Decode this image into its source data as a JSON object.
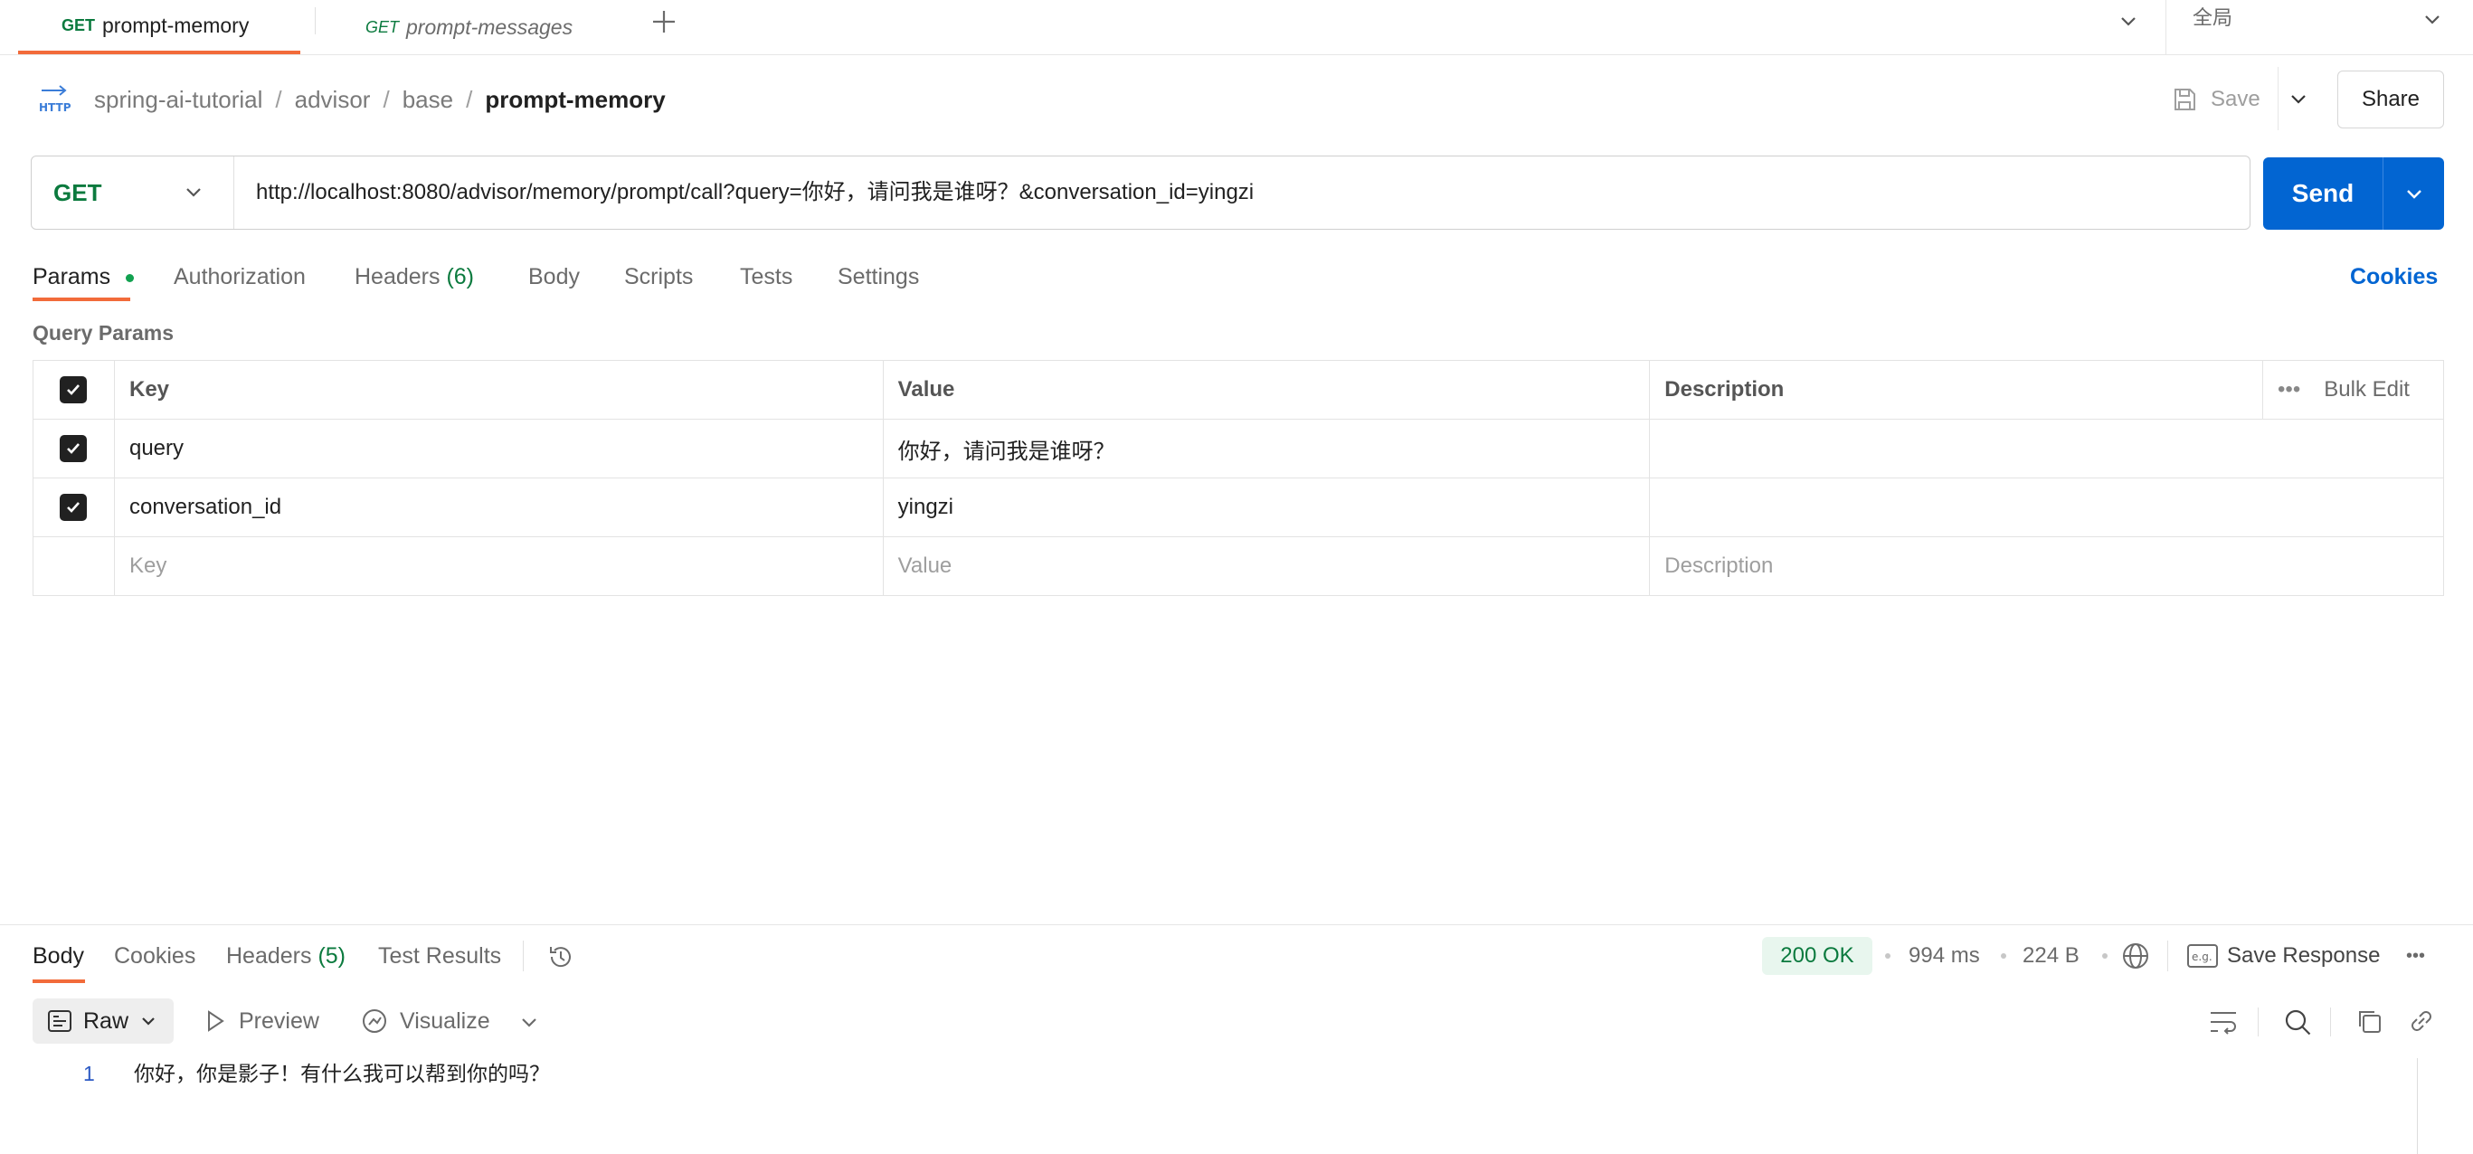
{
  "tabs": [
    {
      "method": "GET",
      "name": "prompt-memory"
    },
    {
      "method": "GET",
      "name": "prompt-messages"
    }
  ],
  "environment": {
    "selected": "全局"
  },
  "breadcrumb": [
    "spring-ai-tutorial",
    "advisor",
    "base",
    "prompt-memory"
  ],
  "header_actions": {
    "save_label": "Save",
    "share_label": "Share"
  },
  "request": {
    "method": "GET",
    "url": "http://localhost:8080/advisor/memory/prompt/call?query=你好，请问我是谁呀？&conversation_id=yingzi",
    "send_label": "Send"
  },
  "request_tabs": {
    "params": "Params",
    "authorization": "Authorization",
    "headers": "Headers",
    "headers_count": "(6)",
    "body": "Body",
    "scripts": "Scripts",
    "tests": "Tests",
    "settings": "Settings",
    "cookies": "Cookies"
  },
  "params": {
    "section_title": "Query Params",
    "columns": {
      "key": "Key",
      "value": "Value",
      "description": "Description",
      "bulk_edit": "Bulk Edit"
    },
    "rows": [
      {
        "key": "query",
        "value": "你好，请问我是谁呀？",
        "description": ""
      },
      {
        "key": "conversation_id",
        "value": "yingzi",
        "description": ""
      }
    ],
    "placeholder": {
      "key": "Key",
      "value": "Value",
      "description": "Description"
    }
  },
  "response": {
    "tabs": {
      "body": "Body",
      "cookies": "Cookies",
      "headers": "Headers",
      "headers_count": "(5)",
      "test_results": "Test Results"
    },
    "status": "200 OK",
    "time": "994 ms",
    "size": "224 B",
    "save_response": "Save Response",
    "view": {
      "raw": "Raw",
      "preview": "Preview",
      "visualize": "Visualize"
    },
    "lines": [
      {
        "num": "1",
        "text": "你好，你是影子！有什么我可以帮到你的吗？"
      }
    ]
  },
  "colors": {
    "accent": "#f26b3a",
    "send": "#0265d2",
    "method_get": "#0b7a3e",
    "status_ok_bg": "#e8f6ee",
    "link": "#0265d2"
  }
}
